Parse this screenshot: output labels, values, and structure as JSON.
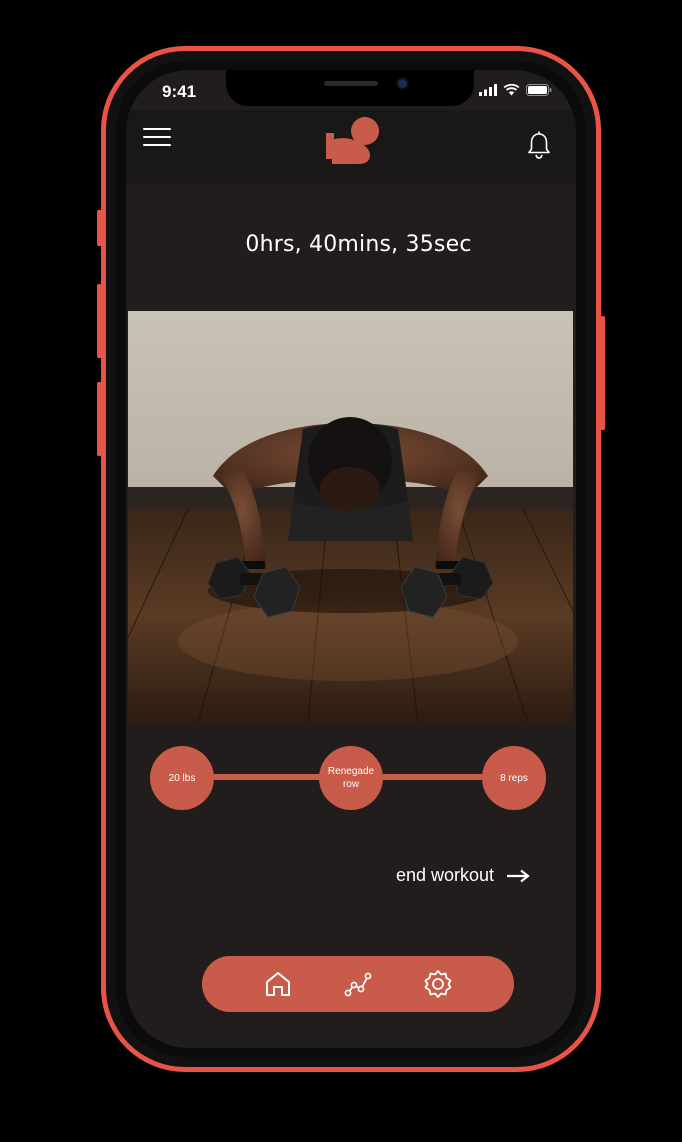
{
  "status_bar": {
    "time": "9:41"
  },
  "header": {
    "menu_icon": "hamburger-menu-icon",
    "logo_icon": "flexed-arm-logo",
    "notification_icon": "bell-icon"
  },
  "workout": {
    "elapsed_time": "0hrs, 40mins, 35sec",
    "steps": [
      {
        "label": "20 lbs"
      },
      {
        "label": "Renegade row"
      },
      {
        "label": "8 reps"
      }
    ],
    "end_label": "end workout"
  },
  "bottom_nav": {
    "items": [
      {
        "icon": "home-icon"
      },
      {
        "icon": "progress-chart-icon"
      },
      {
        "icon": "settings-gear-icon"
      }
    ]
  },
  "colors": {
    "accent": "#c85b49",
    "frame": "#ea5446",
    "background": "#211d1d",
    "header": "#1a1717"
  }
}
